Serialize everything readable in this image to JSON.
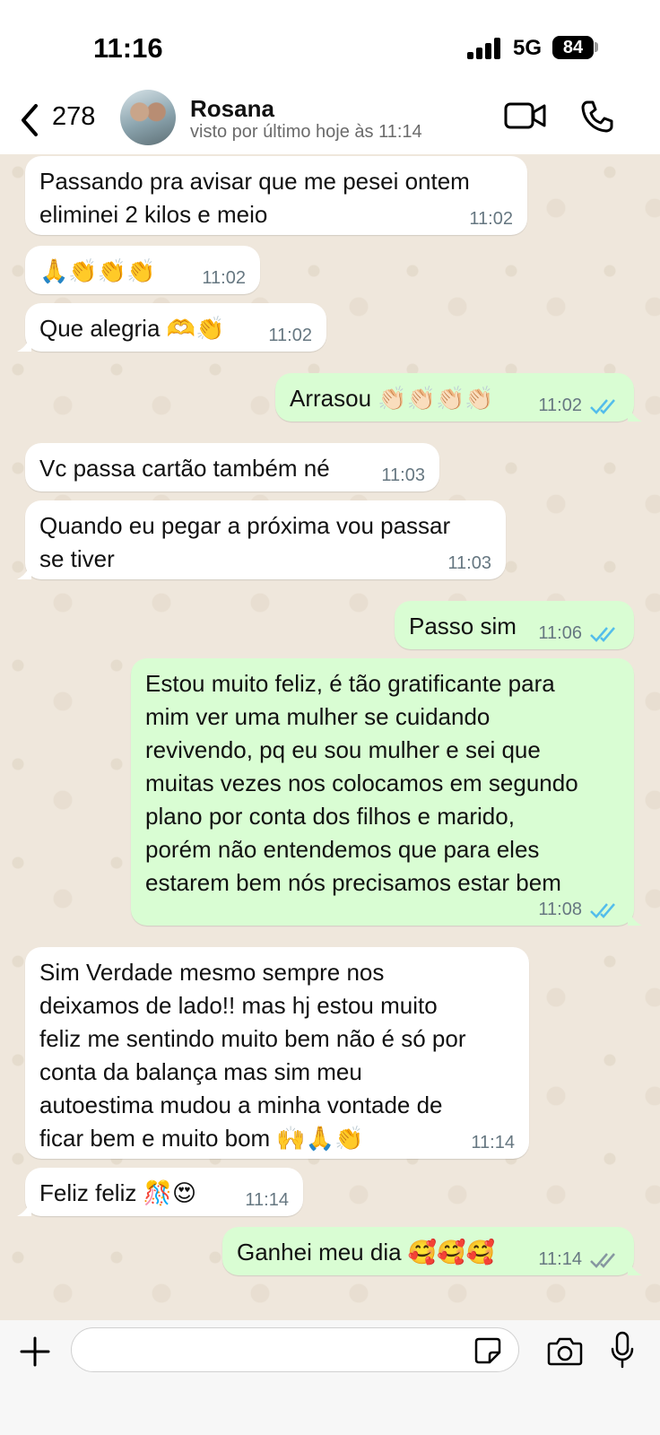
{
  "status_bar": {
    "time": "11:16",
    "network": "5G",
    "battery": "84"
  },
  "header": {
    "back_count": "278",
    "contact_name": "Rosana",
    "contact_status": "visto por último hoje às 11:14"
  },
  "messages": [
    {
      "direction": "in",
      "text": "Passando pra avisar que me pesei ontem\neliminei 2 kilos e meio",
      "time": "11:02"
    },
    {
      "direction": "in",
      "text": "🙏👏👏👏",
      "time": "11:02"
    },
    {
      "direction": "in",
      "text": "Que alegria 🫶👏",
      "time": "11:02"
    },
    {
      "direction": "out",
      "text": "Arrasou 👏🏻👏🏻👏🏻👏🏻",
      "time": "11:02",
      "status": "read"
    },
    {
      "direction": "in",
      "text": "Vc passa cartão também né",
      "time": "11:03"
    },
    {
      "direction": "in",
      "text": "Quando eu pegar a próxima vou passar\nse tiver",
      "time": "11:03"
    },
    {
      "direction": "out",
      "text": "Passo sim",
      "time": "11:06",
      "status": "read"
    },
    {
      "direction": "out",
      "text": "Estou muito feliz, é tão gratificante para\nmim ver uma mulher se cuidando\nrevivendo, pq eu sou mulher e sei que\nmuitas vezes nos colocamos em segundo\nplano por conta dos filhos e marido,\nporém não entendemos que para eles\nestarem bem nós precisamos estar bem",
      "time": "11:08",
      "status": "read"
    },
    {
      "direction": "in",
      "text": "Sim Verdade mesmo sempre nos\ndeixamos de lado!! mas hj estou muito\nfeliz me sentindo muito bem não é só por\nconta da balança mas sim meu\nautoestima mudou a minha vontade de\nficar bem e muito bom 🙌🙏👏",
      "time": "11:14"
    },
    {
      "direction": "in",
      "text": "Feliz feliz 🎊😍",
      "time": "11:14"
    },
    {
      "direction": "out",
      "text": "Ganhei meu dia 🥰🥰🥰",
      "time": "11:14",
      "status": "delivered"
    }
  ],
  "input": {
    "placeholder": ""
  },
  "colors": {
    "tick_read": "#53bdeb",
    "tick_delivered": "#8696a0",
    "bubble_out": "#d9fdd3",
    "bubble_in": "#ffffff"
  }
}
